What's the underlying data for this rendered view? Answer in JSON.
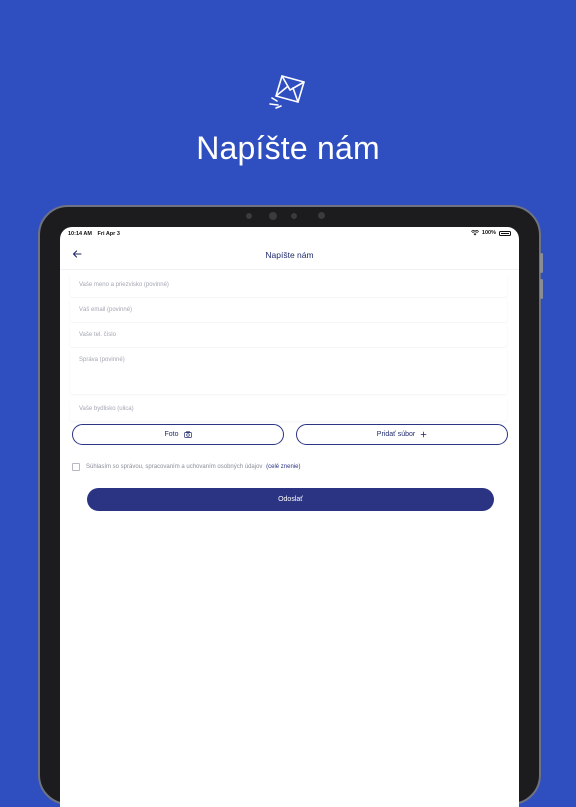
{
  "hero": {
    "title": "Napíšte nám",
    "icon": "envelope-send-icon"
  },
  "status_bar": {
    "time": "10:14 AM",
    "date": "Fri Apr 3",
    "battery": "100%"
  },
  "nav": {
    "title": "Napíšte nám",
    "back_icon": "arrow-left-icon"
  },
  "form": {
    "name_placeholder": "Vaše meno a priezvisko (povinné)",
    "email_placeholder": "Váš email (povinné)",
    "phone_placeholder": "Vaše tel. číslo",
    "message_placeholder": "Správa (povinné)",
    "address_placeholder": "Vaše bydlisko (ulica)",
    "photo_label": "Foto",
    "photo_icon": "camera-icon",
    "attach_label": "Pridať súbor",
    "attach_icon": "plus-icon",
    "consent_text": "Súhlasím so správou, spracovaním a uchovaním osobných údajov",
    "consent_link": "(celé znenie)",
    "submit_label": "Odoslať"
  },
  "colors": {
    "background": "#2f4fc0",
    "primary": "#2b3383",
    "white": "#ffffff"
  }
}
